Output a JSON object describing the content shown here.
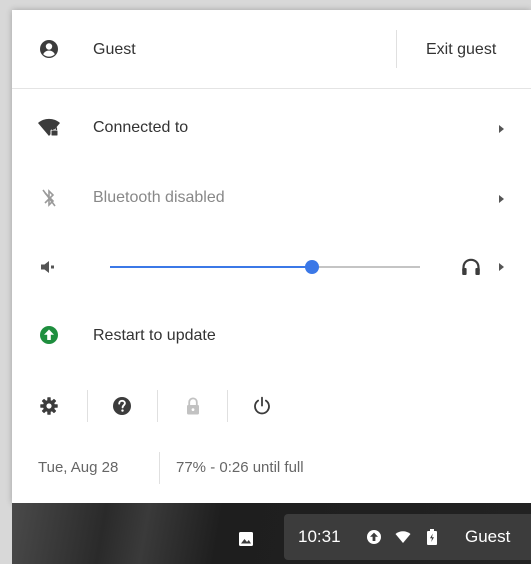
{
  "user": {
    "name": "Guest",
    "exit_label": "Exit guest"
  },
  "network": {
    "label": "Connected to",
    "ssid": ""
  },
  "bluetooth": {
    "label": "Bluetooth disabled"
  },
  "volume": {
    "level": 0.65,
    "output_icon": "headphones-icon"
  },
  "update": {
    "label": "Restart to update"
  },
  "footer": {
    "date": "Tue, Aug 28",
    "battery": "77% - 0:26 until full"
  },
  "system_actions": [
    "settings-icon",
    "help-icon",
    "lock-icon",
    "power-icon"
  ],
  "tray": {
    "time": "10:31",
    "user": "Guest"
  },
  "colors": {
    "accent": "#3b78e7",
    "update_green": "#1e8e3e",
    "tray_bg": "#3c3c3c"
  }
}
